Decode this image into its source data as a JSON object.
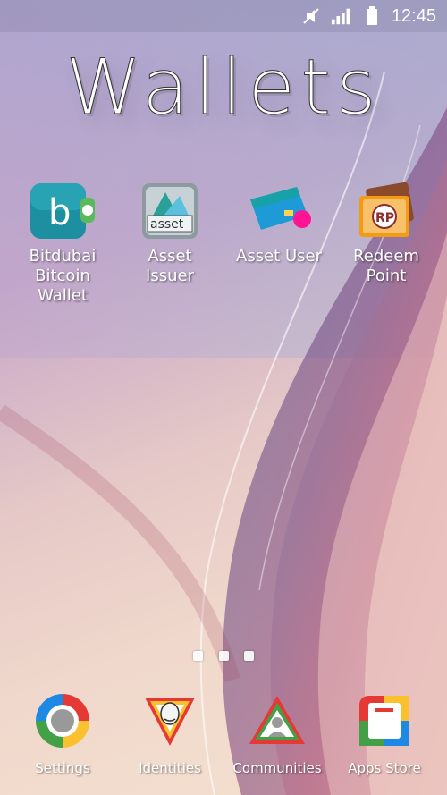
{
  "status_bar": {
    "time": "12:45",
    "icons": [
      "mute-icon",
      "signal-icon",
      "battery-icon"
    ]
  },
  "home": {
    "title": "Wallets",
    "apps": [
      {
        "label": "Bitdubai\nBitcoin\nWallet",
        "icon": "bitcoin-wallet-icon"
      },
      {
        "label": "Asset\nIssuer",
        "icon": "asset-issuer-icon"
      },
      {
        "label": "Asset User",
        "icon": "asset-user-icon"
      },
      {
        "label": "Redeem\nPoint",
        "icon": "redeem-point-icon"
      }
    ],
    "page_indicator": {
      "pages": 3
    }
  },
  "dock": {
    "apps": [
      {
        "label": "Settings",
        "icon": "settings-icon"
      },
      {
        "label": "Identities",
        "icon": "identities-icon"
      },
      {
        "label": "Communities",
        "icon": "communities-icon"
      },
      {
        "label": "Apps Store",
        "icon": "apps-store-icon"
      }
    ]
  }
}
